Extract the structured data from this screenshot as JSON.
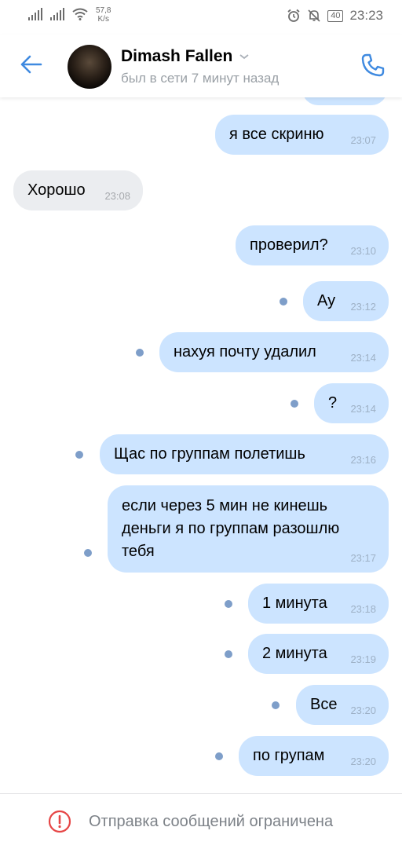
{
  "status_bar": {
    "net_speed_value": "57,8",
    "net_speed_unit": "K/s",
    "battery": "40",
    "time": "23:23"
  },
  "header": {
    "contact_name": "Dimash Fallen",
    "last_seen": "был в сети 7 минут назад",
    "icons": [
      "back-arrow-icon",
      "chevron-down-icon",
      "phone-icon"
    ],
    "accent_color": "#3f8ae0"
  },
  "messages": [
    {
      "text": "я все скриню",
      "time": "23:07",
      "direction": "out",
      "unread": false
    },
    {
      "text": "Хорошо",
      "time": "23:08",
      "direction": "in",
      "unread": false
    },
    {
      "text": "проверил?",
      "time": "23:10",
      "direction": "out",
      "unread": false
    },
    {
      "text": "Ау",
      "time": "23:12",
      "direction": "out",
      "unread": true
    },
    {
      "text": "нахуя почту удалил",
      "time": "23:14",
      "direction": "out",
      "unread": true
    },
    {
      "text": "?",
      "time": "23:14",
      "direction": "out",
      "unread": true
    },
    {
      "text": "Щас по группам полетишь",
      "time": "23:16",
      "direction": "out",
      "unread": true
    },
    {
      "text": "если через 5 мин не кинешь деньги я по группам разошлю тебя",
      "time": "23:17",
      "direction": "out",
      "unread": true
    },
    {
      "text": "1 минута",
      "time": "23:18",
      "direction": "out",
      "unread": true
    },
    {
      "text": "2 минута",
      "time": "23:19",
      "direction": "out",
      "unread": true
    },
    {
      "text": "Все",
      "time": "23:20",
      "direction": "out",
      "unread": true
    },
    {
      "text": "по групам",
      "time": "23:20",
      "direction": "out",
      "unread": true
    }
  ],
  "footer": {
    "restriction_text": "Отправка сообщений ограничена",
    "restriction_icon": "warning-circle-icon",
    "warning_color": "#e64646"
  },
  "colors": {
    "outgoing_bubble": "#cce4ff",
    "incoming_bubble": "#ebedf0",
    "unread_dot": "#7e9ec9"
  }
}
